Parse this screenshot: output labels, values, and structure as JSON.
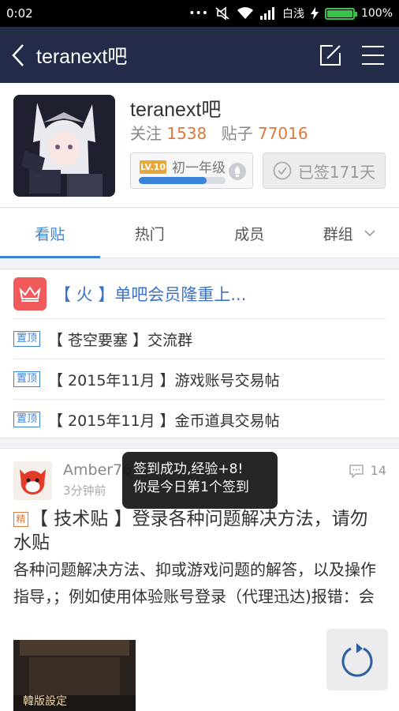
{
  "status_bar": {
    "time": "0:02",
    "carrier": "白浅",
    "battery": "100%",
    "icons": [
      "notification-dots-icon",
      "mute-icon",
      "wifi-icon",
      "signal-icon",
      "charging-icon",
      "battery-icon"
    ]
  },
  "navbar": {
    "title": "teranext吧",
    "back_icon": "chevron-left-icon",
    "actions": [
      "compose-icon",
      "menu-icon"
    ]
  },
  "forum": {
    "name": "teranext吧",
    "follow_label": "关注",
    "follow_count": "1538",
    "posts_label": "贴子",
    "posts_count": "77016",
    "level_badge": "LV.10",
    "level_title": "初一年级",
    "level_progress": 0.78,
    "signed_text": "已签171天"
  },
  "tabs": [
    {
      "label": "看贴",
      "active": true
    },
    {
      "label": "热门",
      "active": false
    },
    {
      "label": "成员",
      "active": false
    },
    {
      "label": "群组",
      "active": false
    }
  ],
  "promo": {
    "text": "【 火 】单吧会员隆重上..."
  },
  "sticky_posts": [
    {
      "tag": "置顶",
      "title": "【 苍空要塞 】交流群"
    },
    {
      "tag": "置顶",
      "title": "【 2015年11月 】游戏账号交易帖"
    },
    {
      "tag": "置顶",
      "title": "【 2015年11月 】金币道具交易帖"
    }
  ],
  "post": {
    "author": "Amber767",
    "time": "3分钟前",
    "comment_count": "14",
    "badge": "精",
    "title": "【 技术贴 】登录各种问题解决方法，请勿水贴",
    "body": "各种问题解决方法、抑或游戏问题的解答，以及操作指导，；例如使用体验账号登录（代理迅达)报错：会",
    "thumb_caption": "韓版設定"
  },
  "toast": {
    "line1": "签到成功,经验+8!",
    "line2": "你是今日第1个签到"
  },
  "colors": {
    "navbar": "#232b48",
    "accent_blue": "#3b83d9",
    "accent_orange": "#e0783a",
    "promo_red": "#f05a5a"
  }
}
